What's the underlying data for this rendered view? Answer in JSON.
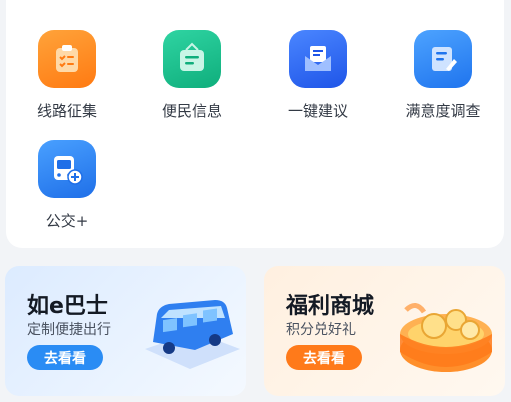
{
  "services": [
    {
      "label": "线路征集",
      "icon": "route-collection-icon",
      "color": "#ff8a1f"
    },
    {
      "label": "便民信息",
      "icon": "info-board-icon",
      "color": "#17c08f"
    },
    {
      "label": "一键建议",
      "icon": "mail-suggestion-icon",
      "color": "#2e6df5"
    },
    {
      "label": "满意度调查",
      "icon": "survey-icon",
      "color": "#2f8bff"
    },
    {
      "label": "公交+",
      "icon": "bus-plus-icon",
      "color": "#2f86f6"
    }
  ],
  "promos": [
    {
      "title": "如e巴士",
      "subtitle": "定制便捷出行",
      "button": "去看看",
      "icon": "bus-illustration-icon",
      "accent": "#2a8cf4"
    },
    {
      "title": "福利商城",
      "subtitle": "积分兑好礼",
      "button": "去看看",
      "icon": "gift-coins-icon",
      "accent": "#ff7a1a"
    }
  ]
}
